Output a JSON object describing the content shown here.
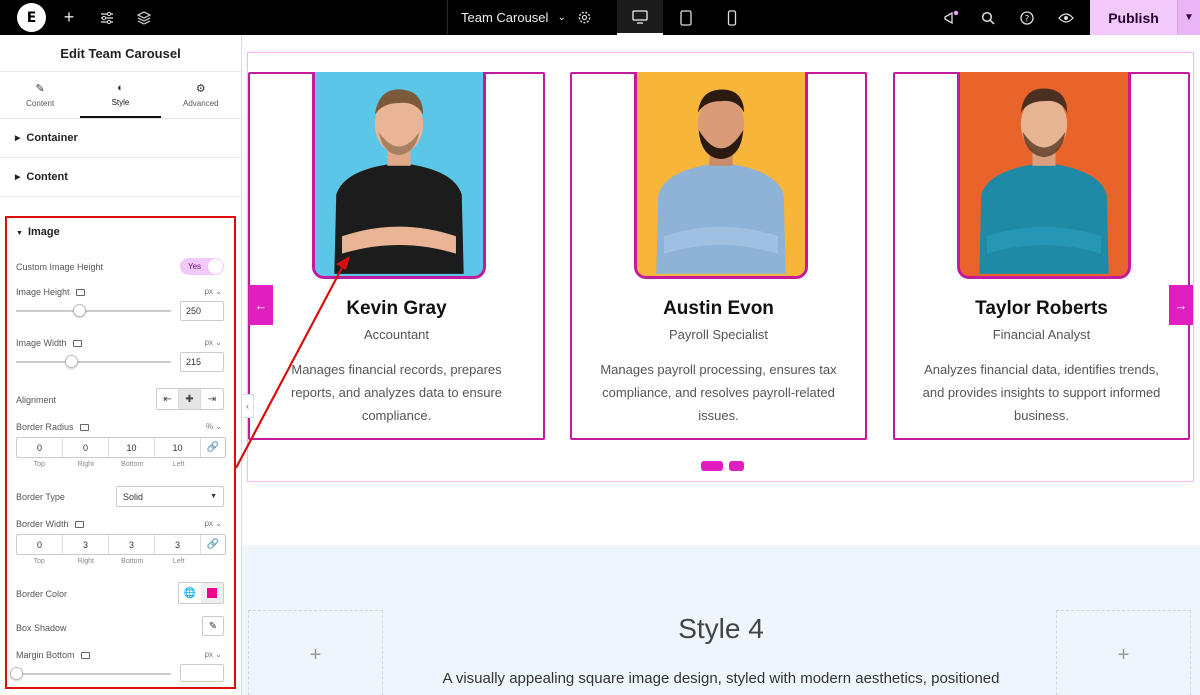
{
  "topbar": {
    "logo_letter": "E",
    "doc_title": "Team Carousel",
    "publish_label": "Publish"
  },
  "panel": {
    "title": "Edit Team Carousel",
    "tabs": [
      {
        "label": "Content",
        "icon": "pencil-icon"
      },
      {
        "label": "Style",
        "icon": "half-circle-icon"
      },
      {
        "label": "Advanced",
        "icon": "gear-icon"
      }
    ],
    "sections": {
      "container": "Container",
      "content": "Content",
      "image": "Image"
    },
    "controls": {
      "custom_height_label": "Custom Image Height",
      "custom_height_value": "Yes",
      "image_height_label": "Image Height",
      "image_height_unit": "px",
      "image_height_value": "250",
      "image_width_label": "Image Width",
      "image_width_unit": "px",
      "image_width_value": "215",
      "alignment_label": "Alignment",
      "border_radius_label": "Border Radius",
      "border_radius_unit": "%",
      "border_radius": [
        "0",
        "0",
        "10",
        "10"
      ],
      "dim_labels": [
        "Top",
        "Right",
        "Bottom",
        "Left"
      ],
      "border_type_label": "Border Type",
      "border_type_value": "Solid",
      "border_width_label": "Border Width",
      "border_width_unit": "px",
      "border_width": [
        "0",
        "3",
        "3",
        "3"
      ],
      "border_color_label": "Border Color",
      "border_color_value": "#ec008c",
      "box_shadow_label": "Box Shadow",
      "margin_bottom_label": "Margin Bottom",
      "margin_bottom_unit": "px"
    }
  },
  "carousel": {
    "accent": "#e01fc0",
    "cards": [
      {
        "name": "Kevin Gray",
        "role": "Accountant",
        "desc": "Manages financial records, prepares reports, and analyzes data to ensure compliance.",
        "bg": "#5cc6e8",
        "shirt": "#1c1c1c"
      },
      {
        "name": "Austin Evon",
        "role": "Payroll Specialist",
        "desc": "Manages payroll processing, ensures tax compliance, and resolves payroll-related issues.",
        "bg": "#f7b53a",
        "shirt": "#8fb3d6"
      },
      {
        "name": "Taylor Roberts",
        "role": "Financial Analyst",
        "desc": "Analyzes financial data, identifies trends, and provides insights to support informed business.",
        "bg": "#e8642a",
        "shirt": "#1f8aa6"
      }
    ]
  },
  "style4": {
    "title": "Style 4",
    "text": "A visually appealing square image design, styled with modern aesthetics, positioned"
  }
}
